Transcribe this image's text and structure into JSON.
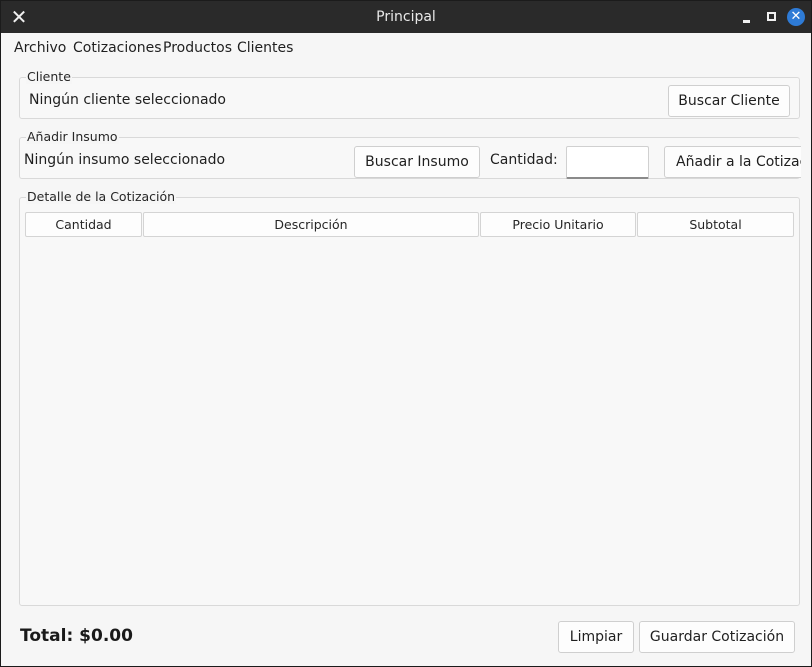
{
  "window": {
    "title": "Principal"
  },
  "menu": {
    "items": [
      "Archivo",
      "Cotizaciones",
      "Productos",
      "Clientes"
    ]
  },
  "cliente": {
    "group_title": "Cliente",
    "status": "Ningún cliente seleccionado",
    "search_label": "Buscar Cliente"
  },
  "insumo": {
    "group_title": "Añadir Insumo",
    "status": "Ningún insumo seleccionado",
    "search_label": "Buscar Insumo",
    "quantity_label": "Cantidad:",
    "quantity_value": "",
    "add_label": "Añadir a la Cotizac"
  },
  "detalle": {
    "group_title": "Detalle de la Cotización",
    "columns": [
      "Cantidad",
      "Descripción",
      "Precio Unitario",
      "Subtotal"
    ],
    "rows": []
  },
  "footer": {
    "total_label": "Total: $0.00",
    "clear_label": "Limpiar",
    "save_label": "Guardar Cotización"
  },
  "icons": {
    "close_left": "close-icon",
    "minimize": "minimize-icon",
    "maximize": "maximize-icon",
    "close": "close-circle-icon"
  },
  "colors": {
    "titlebar": "#2a2a2a",
    "accent_close": "#2e7bd6",
    "window_bg": "#f6f6f6"
  }
}
